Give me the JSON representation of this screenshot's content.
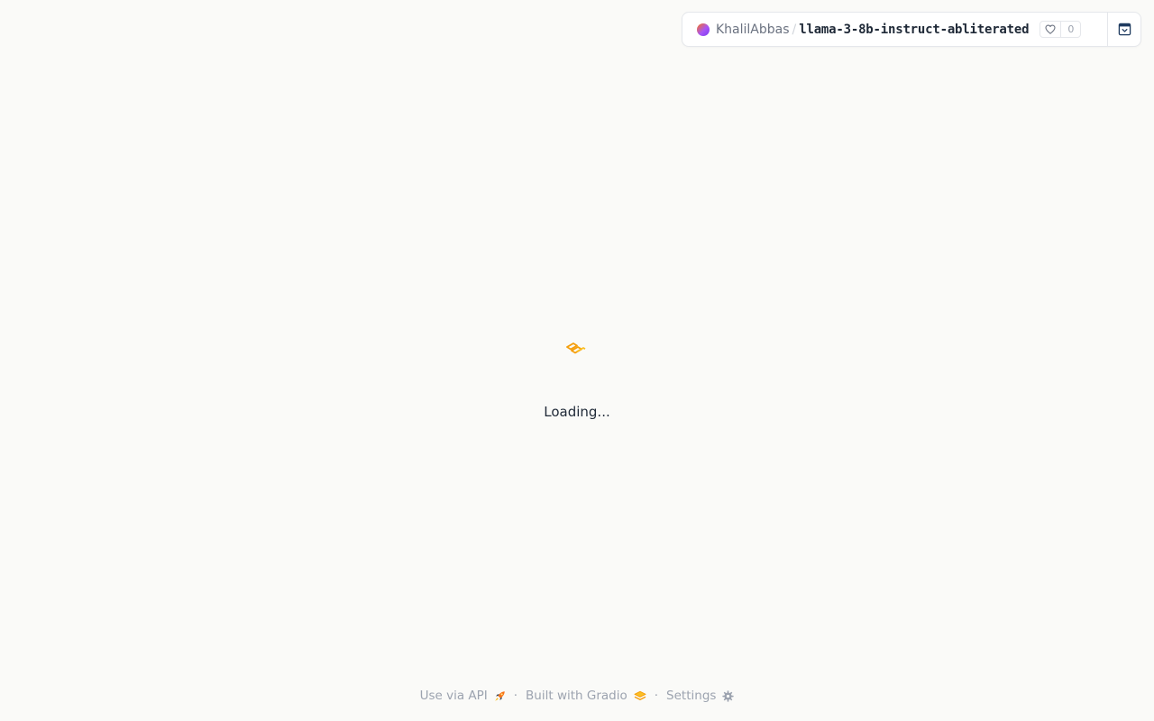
{
  "header": {
    "owner": "KhalilAbbas",
    "separator": "/",
    "space_name": "llama-3-8b-instruct-abliterated",
    "like_count": "0",
    "like_icon": "heart-icon",
    "collapse_icon": "collapse-window-icon",
    "avatar_colors": [
      "#f97316",
      "#a855f7"
    ]
  },
  "main": {
    "loading_text": "Loading...",
    "loader_icon": "gradio-logo-icon",
    "accent_color": "#f59e0b"
  },
  "footer": {
    "api_label": "Use via API",
    "api_icon": "rocket-icon",
    "gradio_label": "Built with Gradio",
    "gradio_icon": "gradio-logo-icon",
    "settings_label": "Settings",
    "settings_icon": "gear-icon",
    "separator": "·"
  }
}
